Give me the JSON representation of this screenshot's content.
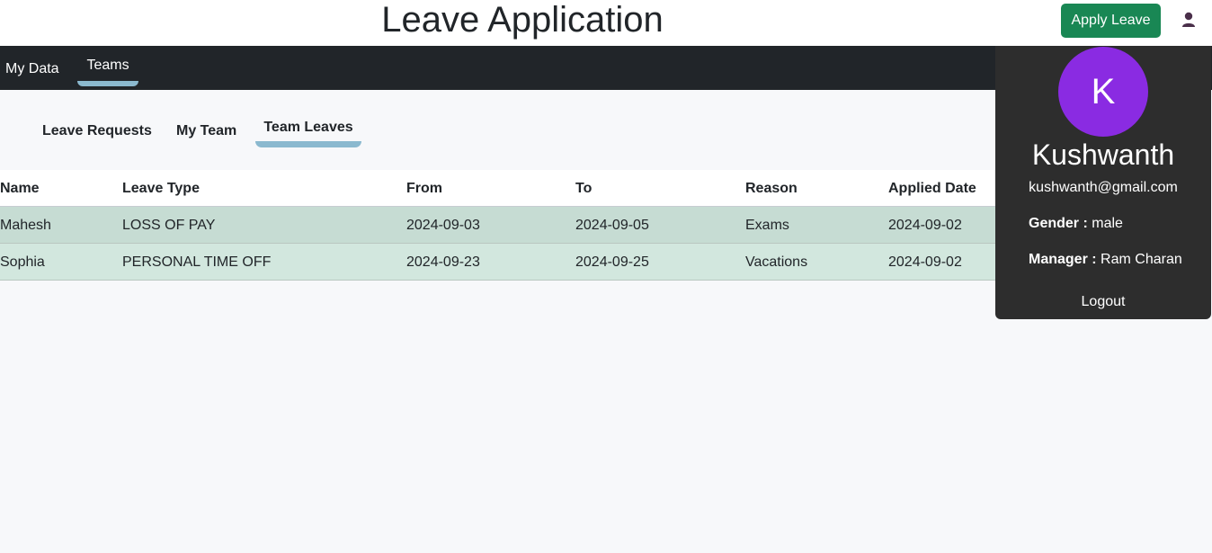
{
  "header": {
    "title": "Leave Application",
    "apply_button": "Apply Leave",
    "user_icon": "user-icon"
  },
  "navbar": {
    "items": [
      {
        "label": "My Data"
      },
      {
        "label": "Teams",
        "active": true
      }
    ]
  },
  "subtabs": {
    "items": [
      {
        "label": "Leave Requests"
      },
      {
        "label": "My Team"
      },
      {
        "label": "Team Leaves",
        "active": true
      }
    ]
  },
  "table": {
    "headers": [
      "Name",
      "Leave Type",
      "From",
      "To",
      "Reason",
      "Applied Date"
    ],
    "rows": [
      [
        "Mahesh",
        "LOSS OF PAY",
        "2024-09-03",
        "2024-09-05",
        "Exams",
        "2024-09-02"
      ],
      [
        "Sophia",
        "PERSONAL TIME OFF",
        "2024-09-23",
        "2024-09-25",
        "Vacations",
        "2024-09-02"
      ]
    ]
  },
  "profile": {
    "initial": "K",
    "name": "Kushwanth",
    "email": "kushwanth@gmail.com",
    "gender_label": "Gender :",
    "gender": "male",
    "manager_label": "Manager :",
    "manager": "Ram Charan",
    "logout": "Logout"
  },
  "colors": {
    "accent_green": "#198754",
    "navbar_bg": "#212529",
    "tab_underline": "#8bb9cf",
    "avatar_bg": "#8a2be2",
    "dropdown_bg": "#2d2d2d",
    "row_even": "#c6dcd3",
    "row_odd": "#d2e7de"
  }
}
